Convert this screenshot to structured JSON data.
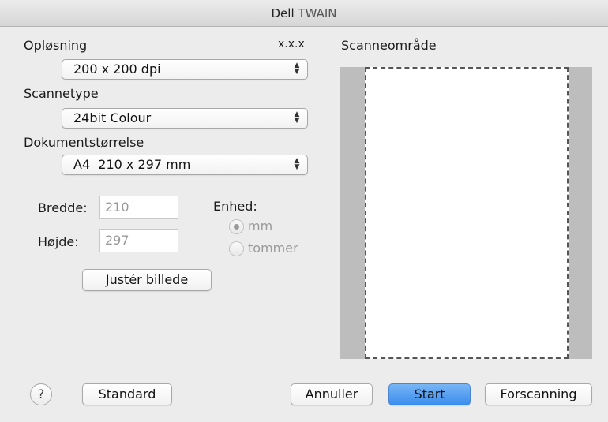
{
  "window": {
    "title_part1": "Dell",
    "title_part2": "TWAIN"
  },
  "version": "x.x.x",
  "resolution": {
    "label": "Opløsning",
    "value": "200 x 200 dpi"
  },
  "scan_type": {
    "label": "Scannetype",
    "value": "24bit Colour"
  },
  "document_size": {
    "label": "Dokumentstørrelse",
    "value": "A4  210 x 297 mm"
  },
  "width": {
    "label": "Bredde:",
    "value": "210"
  },
  "height": {
    "label": "Højde:",
    "value": "297"
  },
  "unit": {
    "label": "Enhed:",
    "options": [
      "mm",
      "tommer"
    ],
    "selected": "mm"
  },
  "adjust_button": "Justér billede",
  "scan_area": {
    "label": "Scanneområde"
  },
  "buttons": {
    "help": "?",
    "standard": "Standard",
    "cancel": "Annuller",
    "start": "Start",
    "prescan": "Forscanning"
  },
  "colors": {
    "default_button": "#3a8ded",
    "scan_area_bg": "#bdbdbd"
  }
}
